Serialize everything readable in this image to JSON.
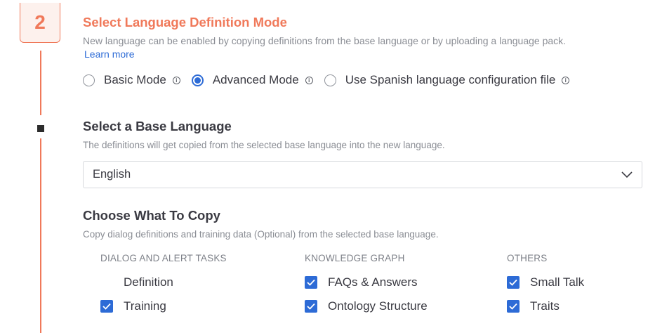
{
  "step": {
    "number": "2"
  },
  "definition_mode": {
    "title": "Select Language Definition Mode",
    "description": "New language can be enabled by copying definitions from the base language or by uploading a language pack.",
    "learn_more": "Learn more",
    "options": [
      {
        "label": "Basic Mode",
        "selected": false,
        "info_icon": "info-icon"
      },
      {
        "label": "Advanced Mode",
        "selected": true,
        "info_icon": "info-icon"
      },
      {
        "label": "Use Spanish language configuration file",
        "selected": false,
        "info_icon": "info-icon"
      }
    ]
  },
  "base_language": {
    "title": "Select a Base Language",
    "description": "The definitions will get copied from the selected base language into the new language.",
    "selected": "English",
    "dropdown_icon": "chevron-down-icon"
  },
  "copy": {
    "title": "Choose What To Copy",
    "description": "Copy dialog definitions and training data (Optional) from the selected base language.",
    "columns": [
      {
        "heading": "DIALOG AND ALERT TASKS",
        "items": [
          {
            "label": "Definition",
            "checked": false
          },
          {
            "label": "Training",
            "checked": true
          }
        ]
      },
      {
        "heading": "KNOWLEDGE GRAPH",
        "items": [
          {
            "label": "FAQs & Answers",
            "checked": true
          },
          {
            "label": "Ontology Structure",
            "checked": true
          }
        ]
      },
      {
        "heading": "OTHERS",
        "items": [
          {
            "label": "Small Talk",
            "checked": true
          },
          {
            "label": "Traits",
            "checked": true
          }
        ]
      }
    ]
  },
  "colors": {
    "accent": "#f0795a",
    "primary": "#2d6bd6",
    "text": "#3a3a42",
    "muted": "#8a8d94"
  }
}
